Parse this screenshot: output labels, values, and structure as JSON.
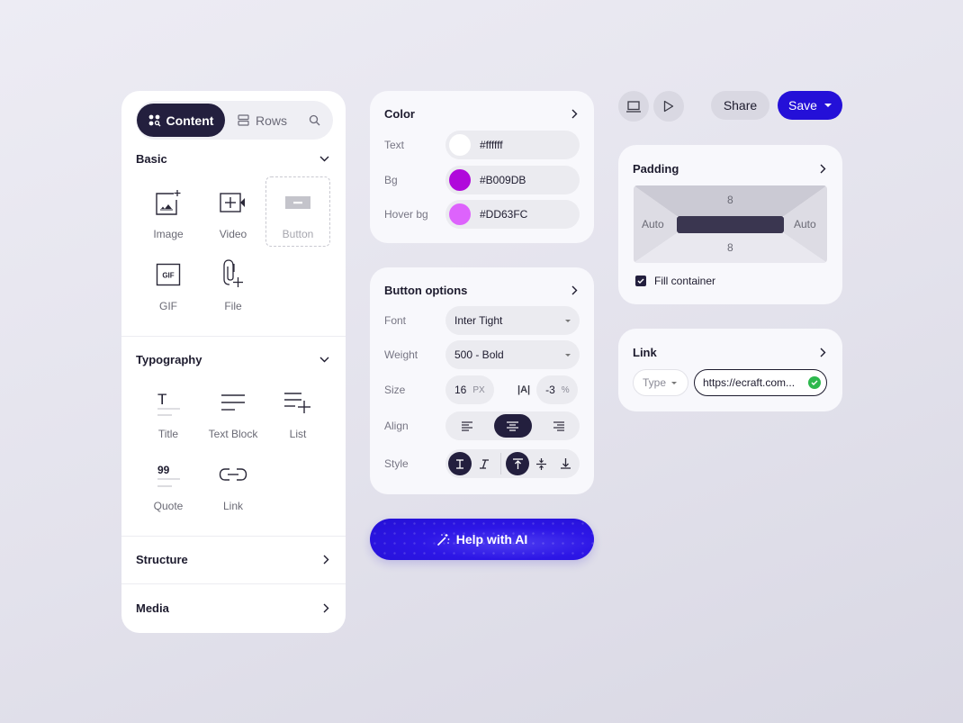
{
  "sidebar": {
    "tabs": [
      {
        "label": "Content",
        "icon": "content-grid-search-icon",
        "active": true
      },
      {
        "label": "Rows",
        "icon": "rows-icon",
        "active": false
      }
    ],
    "search_icon": "search-icon",
    "sections": {
      "basic": {
        "title": "Basic",
        "expanded": true,
        "items": [
          {
            "label": "Image",
            "icon": "image-add-icon"
          },
          {
            "label": "Video",
            "icon": "video-add-icon"
          },
          {
            "label": "Button",
            "icon": "button-icon"
          },
          {
            "label": "GIF",
            "icon": "gif-icon",
            "glyph": "GIF"
          },
          {
            "label": "File",
            "icon": "file-attach-icon"
          }
        ]
      },
      "typography": {
        "title": "Typography",
        "expanded": true,
        "items": [
          {
            "label": "Title",
            "icon": "title-icon",
            "glyph": "T"
          },
          {
            "label": "Text Block",
            "icon": "text-block-icon"
          },
          {
            "label": "List",
            "icon": "list-add-icon"
          },
          {
            "label": "Quote",
            "icon": "quote-icon",
            "glyph": "99"
          },
          {
            "label": "Link",
            "icon": "link-icon"
          }
        ]
      },
      "structure": {
        "title": "Structure",
        "expanded": false
      },
      "media": {
        "title": "Media",
        "expanded": false
      }
    }
  },
  "color_panel": {
    "title": "Color",
    "rows": [
      {
        "label": "Text",
        "value": "#ffffff",
        "swatch": "#ffffff"
      },
      {
        "label": "Bg",
        "value": "#B009DB",
        "swatch": "#B009DB"
      },
      {
        "label": "Hover bg",
        "value": "#DD63FC",
        "swatch": "#DD63FC"
      }
    ]
  },
  "button_options": {
    "title": "Button options",
    "font": {
      "label": "Font",
      "value": "Inter Tight"
    },
    "weight": {
      "label": "Weight",
      "value": "500 - Bold"
    },
    "size": {
      "label": "Size",
      "value": "16",
      "unit": "PX",
      "spacing_glyph": "|A|",
      "spacing_value": "-3",
      "spacing_unit": "%"
    },
    "align": {
      "label": "Align",
      "options": [
        "left",
        "center",
        "right"
      ],
      "selected": "center"
    },
    "style": {
      "label": "Style",
      "options": [
        "upright",
        "italic",
        "top",
        "middle",
        "bottom"
      ],
      "selected": [
        "upright",
        "top"
      ]
    }
  },
  "ai_button": {
    "label": "Help with AI",
    "icon": "magic-wand-icon"
  },
  "toolbar": {
    "desktop_icon": "laptop-icon",
    "preview_icon": "play-icon",
    "share_label": "Share",
    "save_label": "Save"
  },
  "padding_panel": {
    "title": "Padding",
    "top": "8",
    "bottom": "8",
    "left": "Auto",
    "right": "Auto",
    "fill_container": {
      "label": "Fill container",
      "checked": true
    }
  },
  "link_panel": {
    "title": "Link",
    "type_placeholder": "Type",
    "url": "https://ecraft.com...",
    "valid": true
  },
  "colors": {
    "accent": "#2410D8",
    "dark": "#231F3E",
    "success": "#2DB84D"
  }
}
